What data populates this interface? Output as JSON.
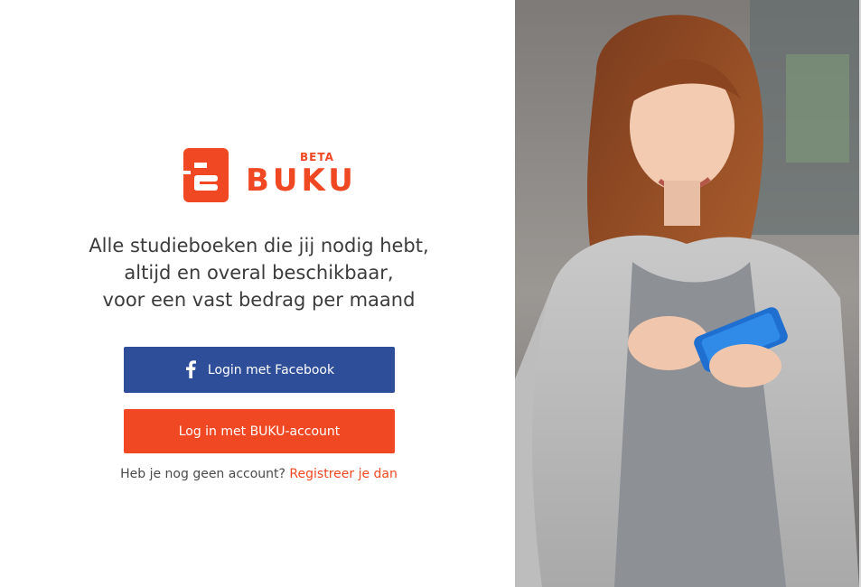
{
  "logo": {
    "beta": "BETA",
    "wordmark": "BUKU",
    "letter": "B"
  },
  "tagline": {
    "line1": "Alle studieboeken die jij nodig hebt,",
    "line2": "altijd en overal beschikbaar,",
    "line3": "voor een vast bedrag per maand"
  },
  "buttons": {
    "facebook_label": "Login met Facebook",
    "buku_label": "Log in met BUKU-account"
  },
  "register": {
    "prompt": "Heb je nog geen account?",
    "link": "Registreer je dan"
  },
  "colors": {
    "brand": "#f04822",
    "facebook": "#2f4e9a",
    "text": "#3c3c3c"
  },
  "icons": {
    "facebook": "facebook-f-icon"
  }
}
